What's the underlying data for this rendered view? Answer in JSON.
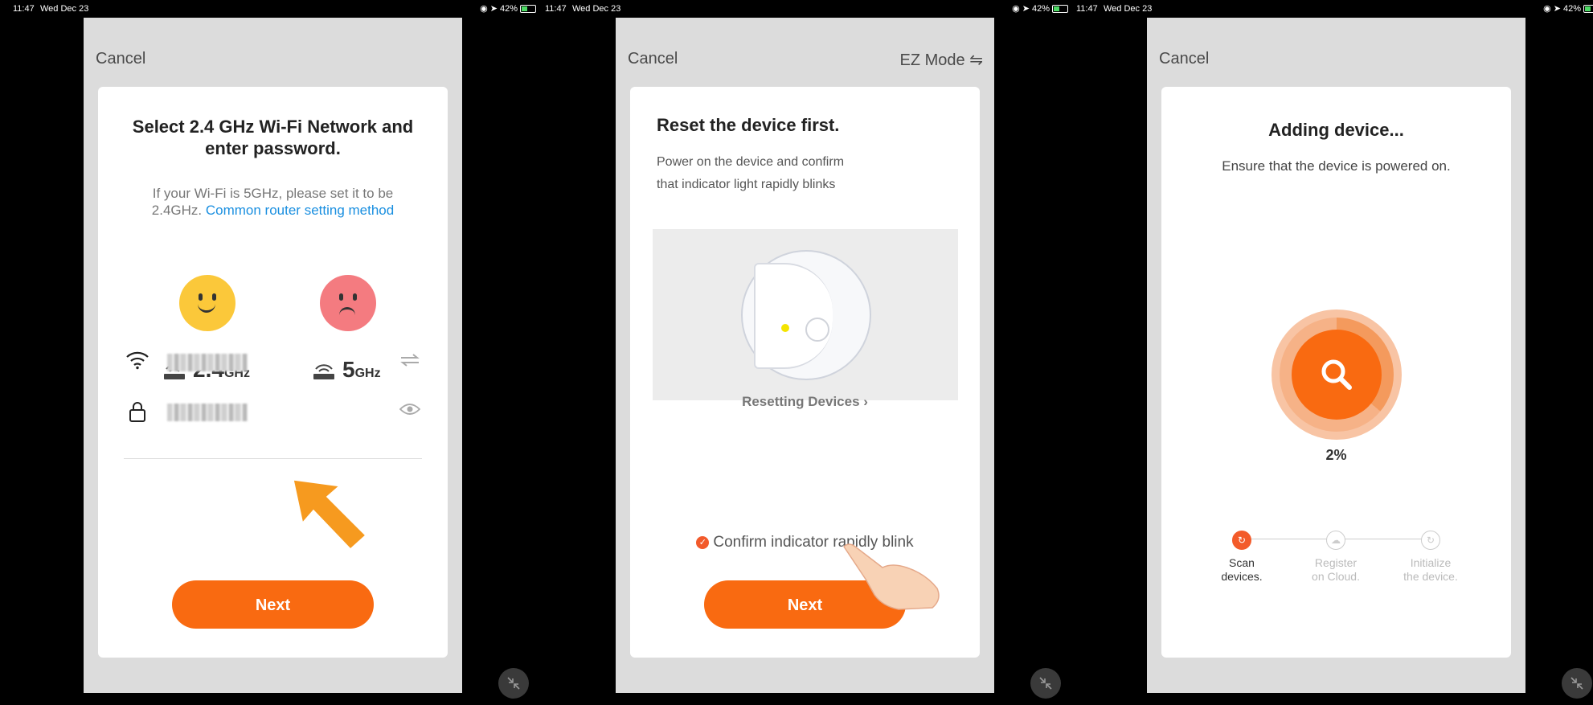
{
  "status_bar": {
    "time": "11:47",
    "date": "Wed Dec 23",
    "battery": "42%"
  },
  "screen1": {
    "cancel": "Cancel",
    "title": "Select 2.4 GHz Wi-Fi Network and enter password.",
    "subtitle": "If your Wi-Fi is 5GHz, please set it to be 2.4GHz.",
    "link": "Common router setting method",
    "band_ok": {
      "value": "2.4",
      "unit": "GHz"
    },
    "band_bad": {
      "value": "5",
      "unit": "GHz"
    },
    "next": "Next"
  },
  "screen2": {
    "cancel": "Cancel",
    "mode": "EZ Mode",
    "mode_icon": "switch-arrows-icon",
    "title": "Reset the device first.",
    "desc_line1": "Power on the device and confirm",
    "desc_line2": "that indicator light rapidly blinks",
    "reset_link": "Resetting Devices",
    "confirm": "Confirm indicator rapidly blink",
    "confirm_checked": true,
    "next": "Next"
  },
  "screen3": {
    "cancel": "Cancel",
    "title": "Adding device...",
    "subtitle": "Ensure that the device is powered on.",
    "progress": "2%",
    "steps": [
      {
        "line1": "Scan",
        "line2": "devices.",
        "state": "active"
      },
      {
        "line1": "Register",
        "line2": "on Cloud.",
        "state": "inactive"
      },
      {
        "line1": "Initialize",
        "line2": "the device.",
        "state": "inactive"
      }
    ]
  },
  "colors": {
    "accent": "#f96a11",
    "link": "#1a8fe0",
    "happy": "#fbc83a",
    "sad": "#f47b80"
  }
}
